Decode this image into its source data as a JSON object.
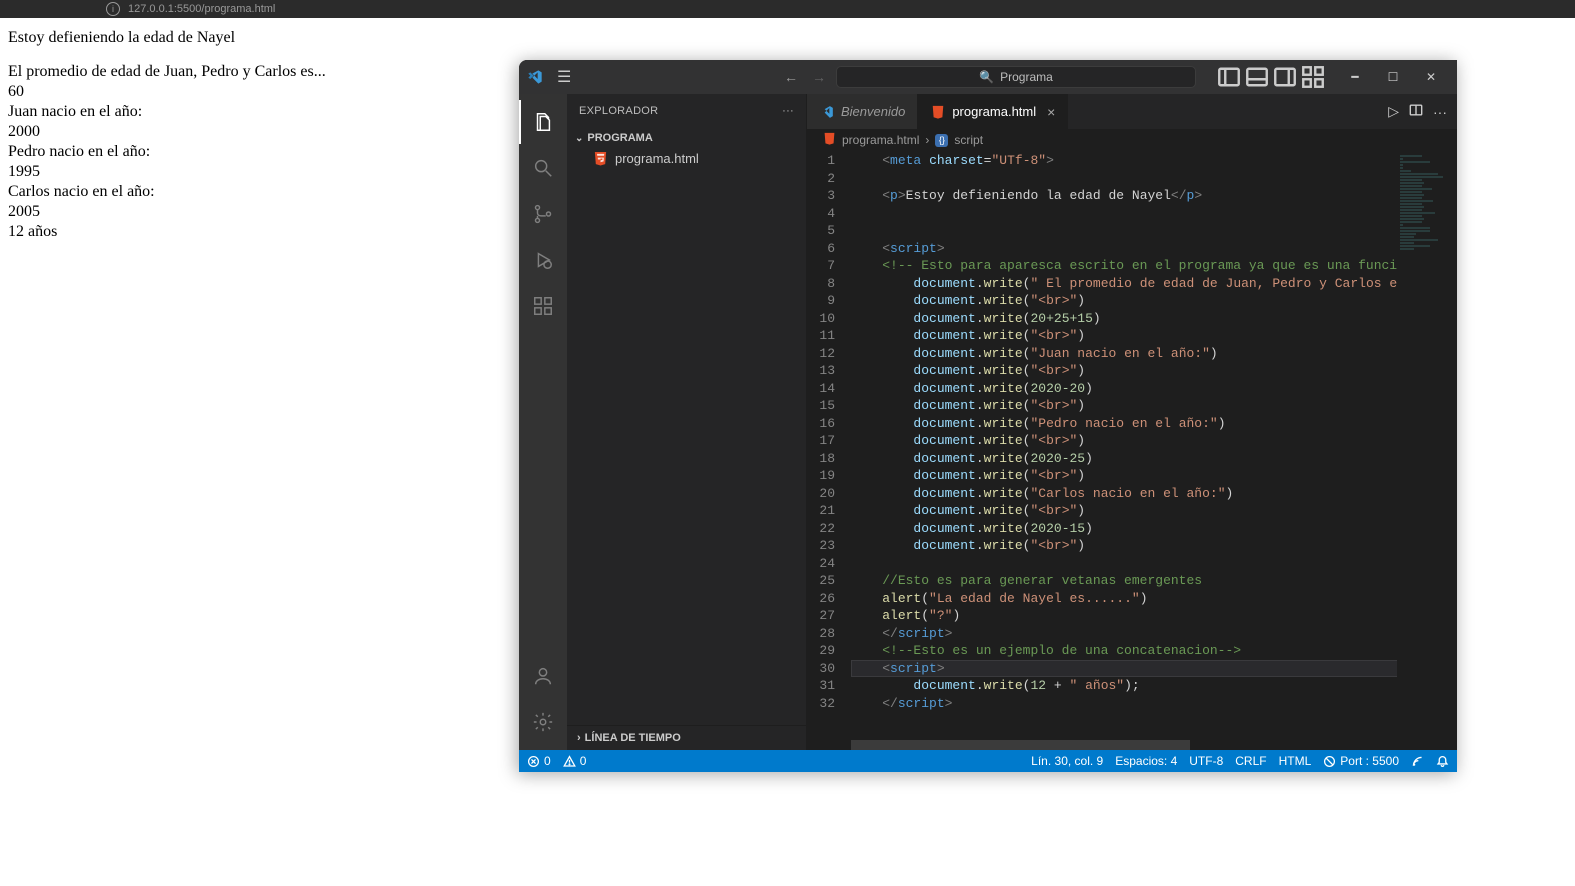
{
  "browser": {
    "url": "127.0.0.1:5500/programa.html"
  },
  "page": {
    "para": "Estoy defieniendo la edad de Nayel",
    "lines": [
      "El promedio de edad de Juan, Pedro y Carlos es...",
      "60",
      "Juan nacio en el año:",
      "2000",
      "Pedro nacio en el año:",
      "1995",
      "Carlos nacio en el año:",
      "2005",
      "12 años"
    ]
  },
  "vscode": {
    "search_placeholder": "Programa",
    "explorer": {
      "title": "EXPLORADOR",
      "folder": "PROGRAMA",
      "file": "programa.html",
      "timeline": "LÍNEA DE TIEMPO"
    },
    "tabs": {
      "welcome": "Bienvenido",
      "active": "programa.html"
    },
    "breadcrumbs": {
      "file": "programa.html",
      "node": "script"
    },
    "code": {
      "start_line": 1,
      "meta_tag": "meta",
      "charset_attr": "charset",
      "charset_val": "\"UTf-8\"",
      "p_text": "Estoy defieniendo la edad de Nayel",
      "script_tag": "script",
      "cmt1": "<!-- Esto para aparesca escrito en el programa ya que es una funcion de ",
      "dw": "document",
      "write": "write",
      "s_promedio": "\" El promedio de edad de Juan, Pedro y Carlos es...\"",
      "s_br": "\"<br>\"",
      "n_sum": "20+25+15",
      "s_juan": "\"Juan nacio en el año:\"",
      "n_2020_20": "2020-20",
      "s_pedro": "\"Pedro nacio en el año:\"",
      "n_2020_25": "2020-25",
      "s_carlos": "\"Carlos nacio en el año:\"",
      "n_2020_15": "2020-15",
      "cmt2": "//Esto es para generar vetanas emergentes",
      "alert": "alert",
      "s_alert1": "\"La edad de Nayel es......\"",
      "s_alert2": "\"?\"",
      "cmt3": "<!--Esto es un ejemplo de una concatenacion-->",
      "n_12": "12",
      "s_anos": "\" años\""
    },
    "status": {
      "errors": "0",
      "warnings": "0",
      "cursor": "Lín. 30, col. 9",
      "spaces": "Espacios: 4",
      "encoding": "UTF-8",
      "eol": "CRLF",
      "lang": "HTML",
      "port": "Port : 5500"
    }
  }
}
